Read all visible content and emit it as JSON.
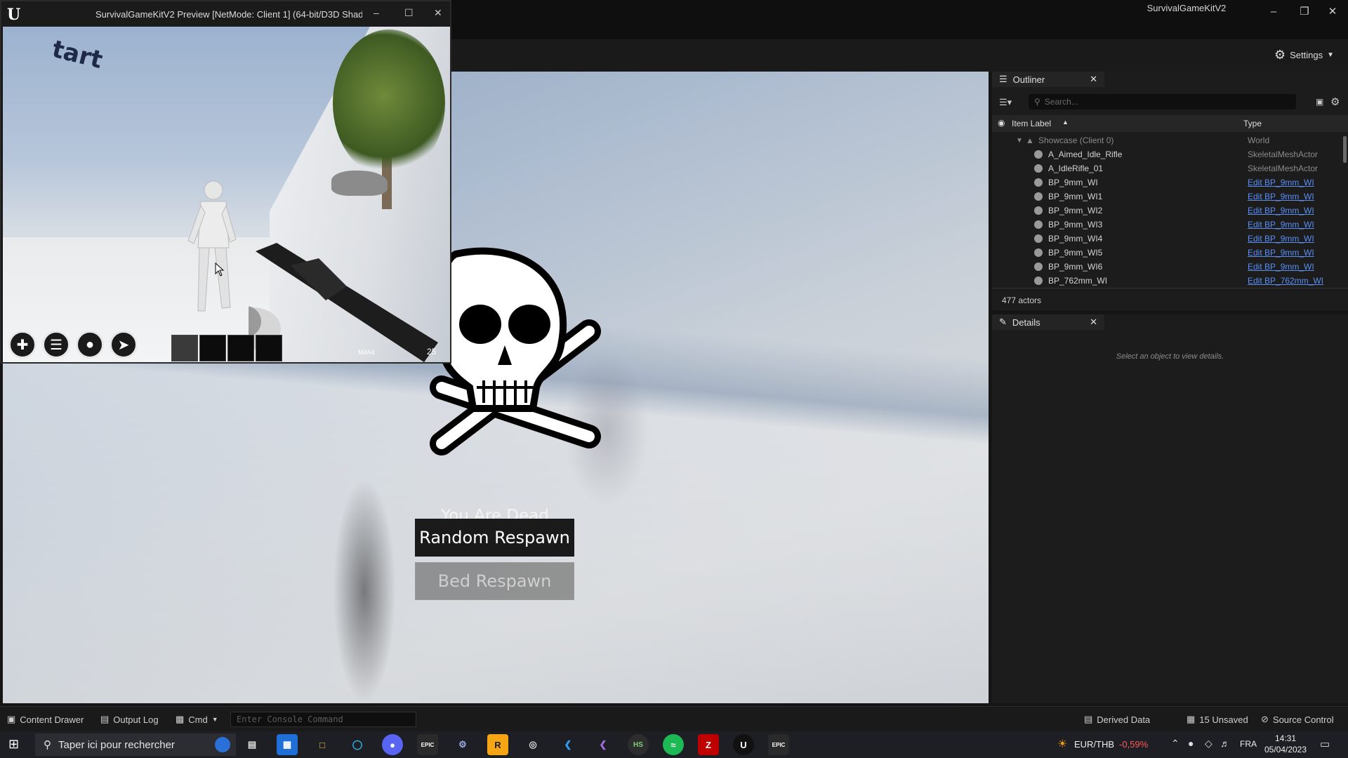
{
  "editor": {
    "app_title": "SurvivalGameKitV2",
    "settings_label": "Settings"
  },
  "pie_window": {
    "title": "SurvivalGameKitV2 Preview [NetMode: Client 1]  (64-bit/D3D Shad",
    "watermark": "tart",
    "weapon_label": "M4A4",
    "ammo": "25",
    "hud_icons": [
      "health-icon",
      "food-icon",
      "water-icon",
      "stamina-icon"
    ]
  },
  "viewport": {
    "death_message": "You Are Dead",
    "random_respawn_label": "Random Respawn",
    "bed_respawn_label": "Bed Respawn"
  },
  "outliner": {
    "tab_label": "Outliner",
    "search_placeholder": "Search...",
    "col_label": "Item Label",
    "col_type": "Type",
    "root": {
      "label": "Showcase (Client 0)",
      "type": "World"
    },
    "rows": [
      {
        "label": "A_Aimed_Idle_Rifle",
        "type": "SkeletalMeshActor",
        "link": false
      },
      {
        "label": "A_IdleRifle_01",
        "type": "SkeletalMeshActor",
        "link": false
      },
      {
        "label": "BP_9mm_WI",
        "type": "Edit BP_9mm_WI",
        "link": true
      },
      {
        "label": "BP_9mm_WI1",
        "type": "Edit BP_9mm_WI",
        "link": true
      },
      {
        "label": "BP_9mm_WI2",
        "type": "Edit BP_9mm_WI",
        "link": true
      },
      {
        "label": "BP_9mm_WI3",
        "type": "Edit BP_9mm_WI",
        "link": true
      },
      {
        "label": "BP_9mm_WI4",
        "type": "Edit BP_9mm_WI",
        "link": true
      },
      {
        "label": "BP_9mm_WI5",
        "type": "Edit BP_9mm_WI",
        "link": true
      },
      {
        "label": "BP_9mm_WI6",
        "type": "Edit BP_9mm_WI",
        "link": true
      },
      {
        "label": "BP_762mm_WI",
        "type": "Edit BP_762mm_WI",
        "link": true
      }
    ],
    "actor_count": "477 actors"
  },
  "details": {
    "tab_label": "Details",
    "empty_message": "Select an object to view details."
  },
  "statusbar": {
    "content_drawer": "Content Drawer",
    "output_log": "Output Log",
    "cmd": "Cmd",
    "console_placeholder": "Enter Console Command",
    "derived_data": "Derived Data",
    "unsaved": "15 Unsaved",
    "source_control": "Source Control"
  },
  "taskbar": {
    "search_placeholder": "Taper ici pour rechercher",
    "currency": "EUR/THB",
    "currency_change": "-0,59%",
    "language": "FRA",
    "time": "14:31",
    "date": "05/04/2023",
    "accent_negative": "#ff5a5a"
  }
}
